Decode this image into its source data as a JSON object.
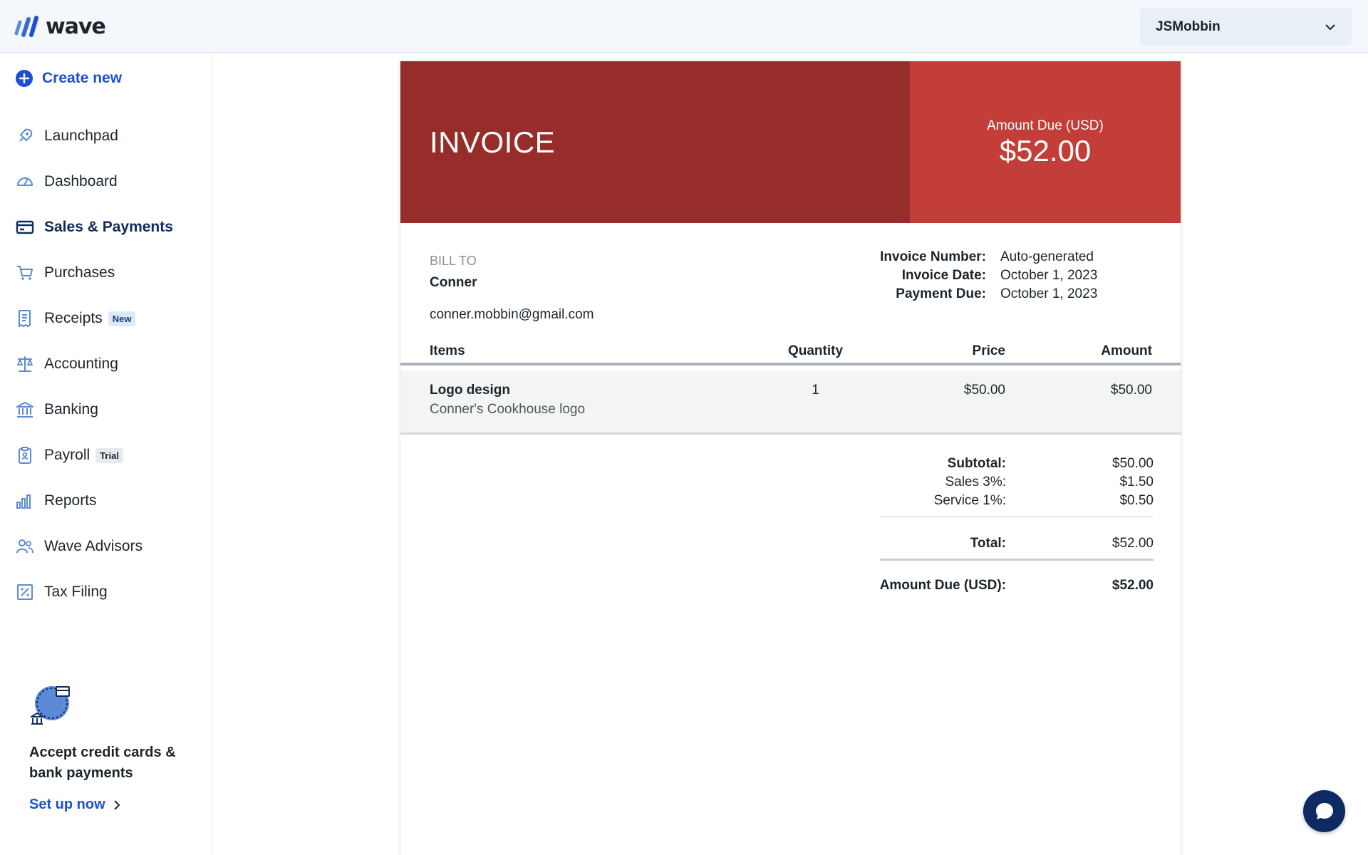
{
  "app": {
    "brand": "wave"
  },
  "header": {
    "business_name": "JSMobbin"
  },
  "sidebar": {
    "create_new": "Create new",
    "items": [
      {
        "label": "Launchpad",
        "icon": "rocket-icon"
      },
      {
        "label": "Dashboard",
        "icon": "gauge-icon"
      },
      {
        "label": "Sales & Payments",
        "icon": "card-icon",
        "active": true
      },
      {
        "label": "Purchases",
        "icon": "cart-icon"
      },
      {
        "label": "Receipts",
        "icon": "receipt-icon",
        "badge": "New"
      },
      {
        "label": "Accounting",
        "icon": "scale-icon"
      },
      {
        "label": "Banking",
        "icon": "bank-icon"
      },
      {
        "label": "Payroll",
        "icon": "clipboard-icon",
        "badge": "Trial"
      },
      {
        "label": "Reports",
        "icon": "bar-chart-icon"
      },
      {
        "label": "Wave Advisors",
        "icon": "people-icon"
      },
      {
        "label": "Tax Filing",
        "icon": "tax-icon"
      }
    ],
    "promo": {
      "title": "Accept credit cards & bank payments",
      "link": "Set up now"
    }
  },
  "invoice": {
    "title": "INVOICE",
    "amount_due_label": "Amount Due (USD)",
    "amount_due_value": "$52.00",
    "bill_to_label": "BILL TO",
    "bill_to_name": "Conner",
    "bill_to_email": "conner.mobbin@gmail.com",
    "meta": [
      {
        "key": "Invoice Number:",
        "value": "Auto-generated"
      },
      {
        "key": "Invoice Date:",
        "value": "October 1, 2023"
      },
      {
        "key": "Payment Due:",
        "value": "October 1, 2023"
      }
    ],
    "columns": {
      "items": "Items",
      "quantity": "Quantity",
      "price": "Price",
      "amount": "Amount"
    },
    "line_items": [
      {
        "name": "Logo design",
        "description": "Conner's Cookhouse logo",
        "quantity": "1",
        "price": "$50.00",
        "amount": "$50.00"
      }
    ],
    "totals": {
      "subtotal_label": "Subtotal:",
      "subtotal": "$50.00",
      "tax1_label": "Sales 3%:",
      "tax1": "$1.50",
      "tax2_label": "Service 1%:",
      "tax2": "$0.50",
      "total_label": "Total:",
      "total": "$52.00",
      "due_label": "Amount Due (USD):",
      "due": "$52.00"
    }
  },
  "colors": {
    "header_dark": "#962d2b",
    "header_light": "#c33e38",
    "accent_blue": "#1c4fd6",
    "nav_icon": "#5b8ad6",
    "chat": "#0d2a63"
  }
}
